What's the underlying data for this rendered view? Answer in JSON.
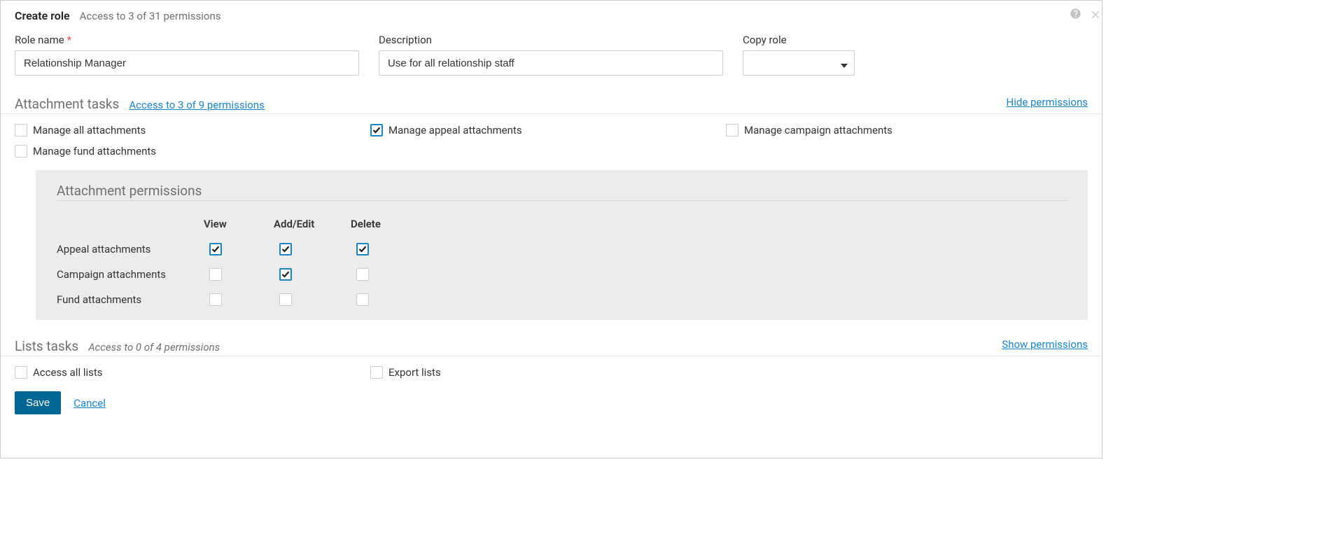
{
  "header": {
    "title": "Create role",
    "subtitle": "Access to 3 of 31 permissions"
  },
  "form": {
    "roleName": {
      "label": "Role name",
      "value": "Relationship Manager"
    },
    "description": {
      "label": "Description",
      "value": "Use for all relationship staff"
    },
    "copyRole": {
      "label": "Copy role",
      "value": ""
    }
  },
  "sections": {
    "attachments": {
      "title": "Attachment tasks",
      "accessLink": "Access to 3 of 9 permissions",
      "action": "Hide permissions",
      "tasks": {
        "manageAll": {
          "label": "Manage all attachments",
          "checked": false
        },
        "manageAppeal": {
          "label": "Manage appeal attachments",
          "checked": true
        },
        "manageCampaign": {
          "label": "Manage campaign attachments",
          "checked": false
        },
        "manageFund": {
          "label": "Manage fund attachments",
          "checked": false
        }
      },
      "panel": {
        "title": "Attachment permissions",
        "columns": {
          "view": "View",
          "addEdit": "Add/Edit",
          "delete": "Delete"
        },
        "rows": {
          "appeal": {
            "label": "Appeal attachments",
            "view": true,
            "addEdit": true,
            "delete": true
          },
          "campaign": {
            "label": "Campaign attachments",
            "view": false,
            "addEdit": true,
            "delete": false
          },
          "fund": {
            "label": "Fund attachments",
            "view": false,
            "addEdit": false,
            "delete": false
          }
        }
      }
    },
    "lists": {
      "title": "Lists tasks",
      "accessText": "Access to 0 of 4 permissions",
      "action": "Show permissions",
      "tasks": {
        "accessAll": {
          "label": "Access all lists",
          "checked": false
        },
        "export": {
          "label": "Export lists",
          "checked": false
        }
      }
    }
  },
  "actions": {
    "save": "Save",
    "cancel": "Cancel"
  }
}
